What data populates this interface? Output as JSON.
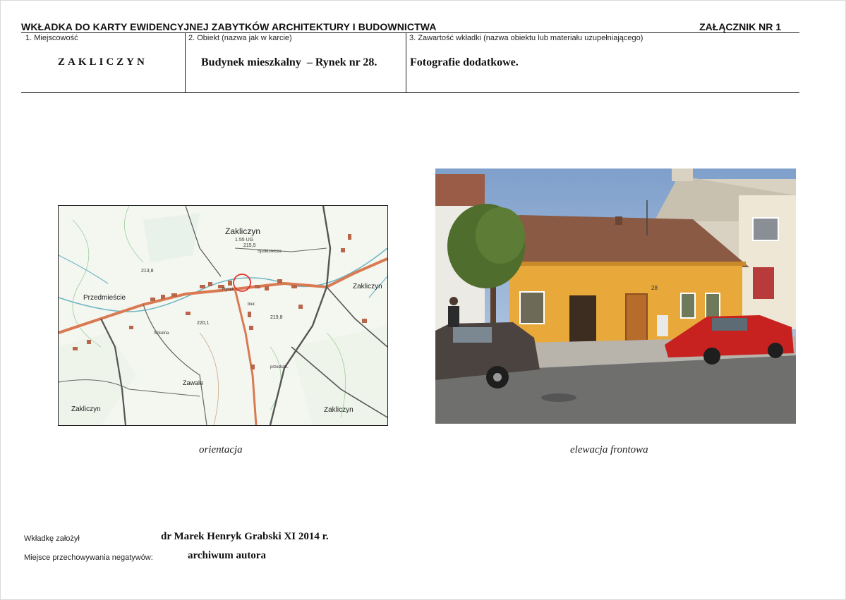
{
  "header": {
    "title": "WKŁADKA DO KARTY EWIDENCYJNEJ ZABYTKÓW ARCHITEKTURY I BUDOWNICTWA",
    "annex": "ZAŁĄCZNIK NR 1"
  },
  "fields": {
    "locality": {
      "label": "1. Miejscowość",
      "value": "ZAKLICZYN"
    },
    "object": {
      "label": "2. Obiekt (nazwa jak w karcie)",
      "value": "Budynek mieszkalny  – Rynek nr 28."
    },
    "contents": {
      "label": "3. Zawartość wkładki (nazwa obiektu lub materiału uzupełniającego)",
      "value": "Fotografie dodatkowe."
    }
  },
  "map": {
    "caption": "orientacja",
    "labels": {
      "town": "Zakliczyn",
      "elev_town": "1.55 UG",
      "elev_215": "215,5",
      "spoldz": "Spółdzielcza",
      "przedmiescie": "Przedmieście",
      "zakliczyn_e": "Zakliczyn",
      "zawale": "Zawale",
      "zakliczyn_sw": "Zakliczyn",
      "zakliczyn_se": "Zakliczyn",
      "przedszk": "przedszk.",
      "h213": "213,8",
      "h220": "220,1",
      "h219": "219,8",
      "szkolna": "Szkolna",
      "rynek": "Rynek",
      "biur": "biur."
    }
  },
  "photo": {
    "caption": "elewacja frontowa",
    "house_number": "28"
  },
  "footer": {
    "founder_label": "Wkładkę założył",
    "founder_value": "dr Marek Henryk Grabski XI 2014 r.",
    "storage_label": "Miejsce przechowywania negatywów:",
    "storage_value": "archiwum autora"
  },
  "colors": {
    "facade": "#e9a93a",
    "roof": "#8a5a45",
    "car_red": "#c7221f",
    "map_road": "#d97a52",
    "map_marker": "#e0322a"
  }
}
